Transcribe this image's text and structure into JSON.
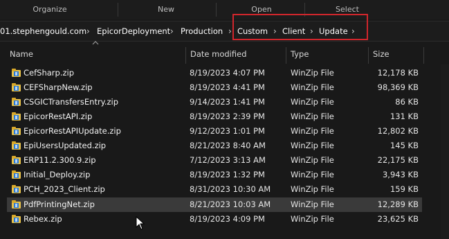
{
  "ribbon": {
    "groups": [
      "Organize",
      "New",
      "Open",
      "Select"
    ]
  },
  "address": {
    "crumbs": [
      "01.stephengould.com",
      "EpicorDeployment",
      "Production",
      "Custom",
      "Client",
      "Update"
    ]
  },
  "columns": {
    "name": "Name",
    "date": "Date modified",
    "type": "Type",
    "size": "Size"
  },
  "files": [
    {
      "name": "CefSharp.zip",
      "date": "8/19/2023 4:07 PM",
      "type": "WinZip File",
      "size": "12,178 KB"
    },
    {
      "name": "CEFSharpNew.zip",
      "date": "8/19/2023 4:41 PM",
      "type": "WinZip File",
      "size": "98,369 KB"
    },
    {
      "name": "CSGICTransfersEntry.zip",
      "date": "9/14/2023 1:41 PM",
      "type": "WinZip File",
      "size": "86 KB"
    },
    {
      "name": "EpicorRestAPI.zip",
      "date": "8/19/2023 2:39 PM",
      "type": "WinZip File",
      "size": "131 KB"
    },
    {
      "name": "EpicorRestAPIUpdate.zip",
      "date": "9/12/2023 1:01 PM",
      "type": "WinZip File",
      "size": "12,802 KB"
    },
    {
      "name": "EpiUsersUpdated.zip",
      "date": "8/21/2023 8:40 AM",
      "type": "WinZip File",
      "size": "145 KB"
    },
    {
      "name": "ERP11.2.300.9.zip",
      "date": "7/12/2023 3:13 AM",
      "type": "WinZip File",
      "size": "22,175 KB"
    },
    {
      "name": "Initial_Deploy.zip",
      "date": "8/19/2023 1:32 PM",
      "type": "WinZip File",
      "size": "3,943 KB"
    },
    {
      "name": "PCH_2023_Client.zip",
      "date": "8/31/2023 10:30 AM",
      "type": "WinZip File",
      "size": "159 KB"
    },
    {
      "name": "PdfPrintingNet.zip",
      "date": "8/21/2023 10:03 AM",
      "type": "WinZip File",
      "size": "12,289 KB",
      "selected": true
    },
    {
      "name": "Rebex.zip",
      "date": "8/19/2023 4:09 PM",
      "type": "WinZip File",
      "size": "23,625 KB"
    }
  ],
  "colors": {
    "background": "#191919",
    "highlight_box": "#d1262c",
    "selected_row": "#3a3a3a"
  },
  "icons": {
    "file": "winzip-file-icon",
    "sort": "sort-up-icon",
    "breadcrumb_separator": "chevron-right-icon"
  }
}
